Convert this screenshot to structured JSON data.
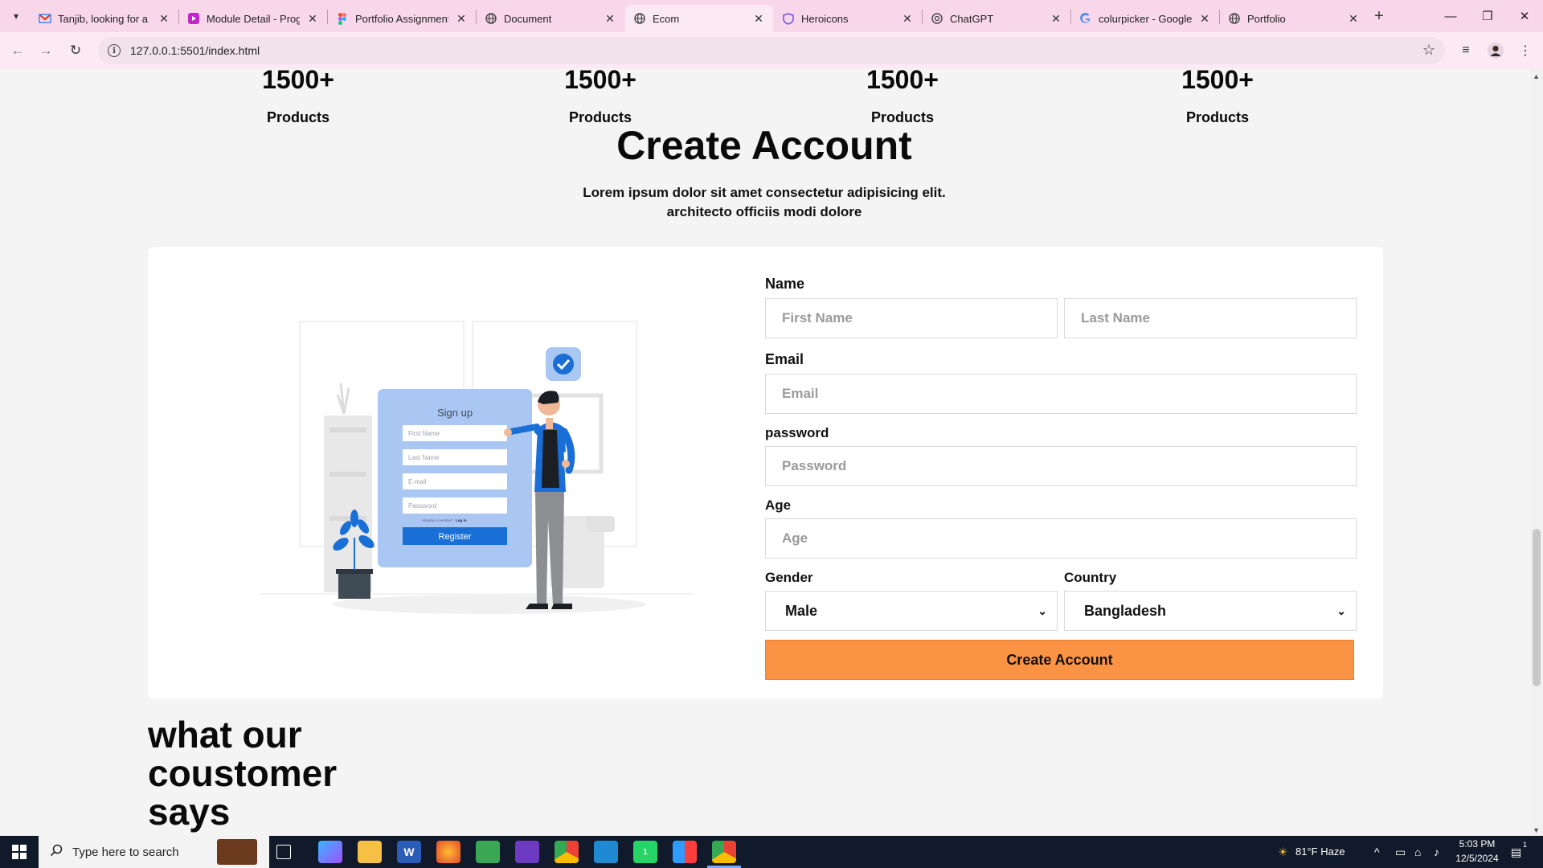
{
  "browser": {
    "tabs": [
      {
        "title": "Tanjib, looking for a n",
        "icon": "gmail-icon",
        "active": false
      },
      {
        "title": "Module Detail - Prog",
        "icon": "module-icon",
        "active": false
      },
      {
        "title": "Portfolio Assignment",
        "icon": "figma-icon",
        "active": false
      },
      {
        "title": "Document",
        "icon": "globe-icon",
        "active": false
      },
      {
        "title": "Ecom",
        "icon": "globe-icon",
        "active": true
      },
      {
        "title": "Heroicons",
        "icon": "heroicons-icon",
        "active": false
      },
      {
        "title": "ChatGPT",
        "icon": "chatgpt-icon",
        "active": false
      },
      {
        "title": "colurpicker - Google",
        "icon": "google-icon",
        "active": false
      },
      {
        "title": "Portfolio",
        "icon": "globe-icon",
        "active": false
      }
    ],
    "url": "127.0.0.1:5501/index.html"
  },
  "stats": [
    {
      "value": "1500+",
      "label": "Products"
    },
    {
      "value": "1500+",
      "label": "Products"
    },
    {
      "value": "1500+",
      "label": "Products"
    },
    {
      "value": "1500+",
      "label": "Products"
    }
  ],
  "create_account": {
    "title": "Create Account",
    "subtitle_line1": "Lorem ipsum dolor sit amet consectetur adipisicing elit.",
    "subtitle_line2": "architecto officiis modi dolore",
    "illustration": {
      "heading": "Sign up",
      "fields": [
        "First Name",
        "Last Name",
        "E-mail",
        "Password"
      ],
      "member_text": "Already a member?",
      "login_text": "Log in",
      "button": "Register"
    },
    "form": {
      "name_label": "Name",
      "first_name_placeholder": "First Name",
      "last_name_placeholder": "Last Name",
      "email_label": "Email",
      "email_placeholder": "Email",
      "password_label": "password",
      "password_placeholder": "Password",
      "age_label": "Age",
      "age_placeholder": "Age",
      "gender_label": "Gender",
      "gender_value": "Male",
      "country_label": "Country",
      "country_value": "Bangladesh",
      "submit_label": "Create Account"
    }
  },
  "testimonial": {
    "heading_line1": "what our",
    "heading_line2": "coustomer",
    "heading_line3": "says"
  },
  "taskbar": {
    "search_placeholder": "Type here to search",
    "weather": "81°F  Haze",
    "time": "5:03 PM",
    "date": "12/5/2024",
    "whatsapp_badge": "1",
    "notification_count": "1"
  },
  "colors": {
    "tabbar": "#f9d7ea",
    "toolbar": "#fbeaf3",
    "accent_button": "#fb9345",
    "illustration_blue": "#1a6fd6",
    "taskbar": "#101a2a"
  }
}
